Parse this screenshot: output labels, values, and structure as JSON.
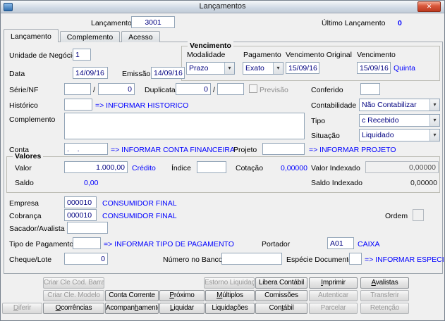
{
  "window": {
    "title": "Lançamentos",
    "close_glyph": "✕"
  },
  "icons": {
    "dropdown": "▾"
  },
  "header": {
    "lancamento_label": "Lançamento",
    "lancamento_value": "3001",
    "ultimo_lancamento_label": "Último Lançamento",
    "ultimo_lancamento_value": "0"
  },
  "tabs": [
    {
      "label": "Lançamento"
    },
    {
      "label": "Complemento"
    },
    {
      "label": "Acesso"
    }
  ],
  "fields": {
    "unidade_negocio": {
      "label": "Unidade de Negócio",
      "value": "1"
    },
    "data": {
      "label": "Data",
      "value": "14/09/16"
    },
    "emissao": {
      "label": "Emissão",
      "value": "14/09/16"
    },
    "serie_nf": {
      "label": "Série/NF",
      "separator": "/",
      "value1": "",
      "value2": "0"
    },
    "duplicata": {
      "label": "Duplicata",
      "separator": "/",
      "value1": "0",
      "value2": ""
    },
    "previsao": {
      "label": "Previsão"
    },
    "conferido": {
      "label": "Conferido",
      "value": ""
    },
    "historico": {
      "label": "Histórico",
      "value": "",
      "hint": "=> INFORMAR HISTORICO"
    },
    "contabilidade": {
      "label": "Contabilidade",
      "value": "Não Contabilizar"
    },
    "complemento": {
      "label": "Complemento",
      "value": ""
    },
    "tipo": {
      "label": "Tipo",
      "value": "c Recebido"
    },
    "situacao": {
      "label": "Situação",
      "value": "Liquidado"
    },
    "conta": {
      "label": "Conta",
      "value": ".    .",
      "hint": "=> INFORMAR CONTA FINANCEIRA"
    },
    "projeto": {
      "label": "Projeto",
      "value": "",
      "hint": "=> INFORMAR PROJETO"
    },
    "empresa": {
      "label": "Empresa",
      "value": "000010",
      "description": "CONSUMIDOR FINAL"
    },
    "cobranca": {
      "label": "Cobrança",
      "value": "000010",
      "description": "CONSUMIDOR FINAL"
    },
    "ordem": {
      "label": "Ordem",
      "value": ""
    },
    "sacador_avalista": {
      "label": "Sacador/Avalista",
      "value": ""
    },
    "tipo_pagamento": {
      "label": "Tipo de Pagamento",
      "value": "",
      "hint": "=> INFORMAR TIPO DE PAGAMENTO"
    },
    "portador": {
      "label": "Portador",
      "value": "A01",
      "description": "CAIXA"
    },
    "cheque_lote": {
      "label": "Cheque/Lote",
      "value": "0"
    },
    "numero_banco": {
      "label": "Número no Banco",
      "value": ""
    },
    "especie_documento": {
      "label": "Espécie Documento",
      "value": "",
      "hint": "=> INFORMAR ESPECIE DE DOCUM"
    }
  },
  "vencimento_group": {
    "title": "Vencimento",
    "modalidade": {
      "label": "Modalidade",
      "value": "Prazo"
    },
    "pagamento": {
      "label": "Pagamento",
      "value": "Exato"
    },
    "vencimento_original": {
      "label": "Vencimento Original",
      "value": "15/09/16"
    },
    "vencimento": {
      "label": "Vencimento",
      "value": "15/09/16",
      "weekday": "Quinta"
    }
  },
  "valores_group": {
    "title": "Valores",
    "valor": {
      "label": "Valor",
      "value": "1.000,00",
      "nature": "Crédito"
    },
    "indice": {
      "label": "Índice",
      "value": ""
    },
    "cotacao": {
      "label": "Cotação",
      "value": "0,00000"
    },
    "valor_indexado": {
      "label": "Valor Indexado",
      "value": "0,00000"
    },
    "saldo": {
      "label": "Saldo",
      "value": "0,00"
    },
    "saldo_indexado": {
      "label": "Saldo Indexado",
      "value": "0,00000"
    }
  },
  "buttons": {
    "row1": [
      {
        "label": "Criar Cle Cod. Barras",
        "enabled": false
      },
      {
        "label": "Estorno Liquidação",
        "enabled": false
      },
      {
        "label": "Libera Contábil",
        "enabled": true
      },
      {
        "label": "Imprimir",
        "enabled": true,
        "u": 0
      },
      {
        "label": "Avalistas",
        "enabled": true,
        "u": 0
      }
    ],
    "row2": [
      {
        "label": "Criar Cle. Modelo",
        "enabled": false
      },
      {
        "label": "Conta Corrente",
        "enabled": true
      },
      {
        "label": "Próximo",
        "enabled": true,
        "u": 0
      },
      {
        "label": "Múltiplos",
        "enabled": true,
        "u": 0
      },
      {
        "label": "Comissões",
        "enabled": true
      },
      {
        "label": "Autenticar",
        "enabled": false
      },
      {
        "label": "Transferir",
        "enabled": false
      }
    ],
    "row3": [
      {
        "label": "Diferir",
        "enabled": false,
        "u": 0
      },
      {
        "label": "Ocorrências",
        "enabled": true,
        "u": 0
      },
      {
        "label": "Acompanhamento",
        "enabled": true,
        "u": 7
      },
      {
        "label": "Liquidar",
        "enabled": true,
        "u": 0
      },
      {
        "label": "Liquidações",
        "enabled": true,
        "u": 7
      },
      {
        "label": "Contábil",
        "enabled": true,
        "u": 3
      },
      {
        "label": "Parcelar",
        "enabled": false
      },
      {
        "label": "Retenção",
        "enabled": false
      }
    ]
  },
  "colors": {
    "hint_blue": "#0000ff",
    "value_navy": "#000080",
    "window_bg": "#f0f0f0"
  }
}
